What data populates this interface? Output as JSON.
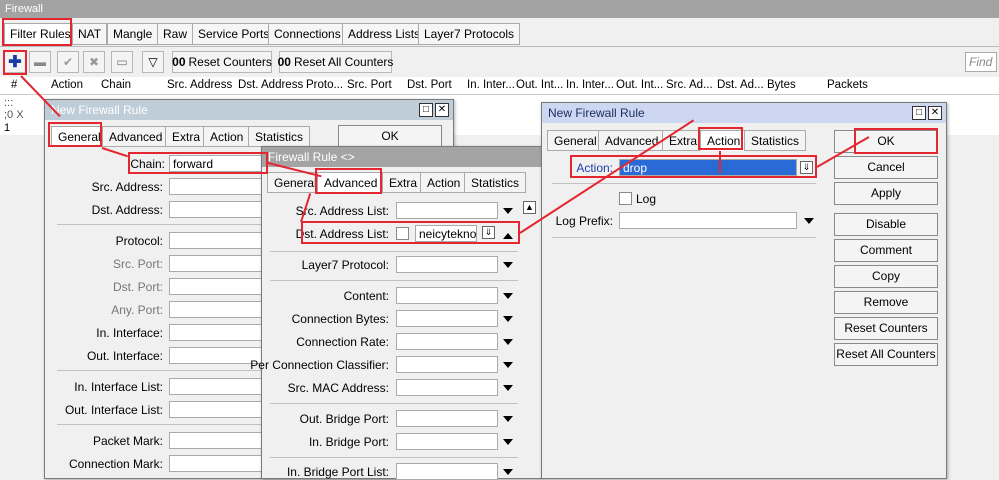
{
  "window": {
    "title": "Firewall"
  },
  "tabs": [
    "Filter Rules",
    "NAT",
    "Mangle",
    "Raw",
    "Service Ports",
    "Connections",
    "Address Lists",
    "Layer7 Protocols"
  ],
  "toolbar": {
    "reset_counters": "Reset Counters",
    "reset_all_counters": "Reset All Counters",
    "find_placeholder": "Find"
  },
  "columns": [
    "#",
    "Action",
    "Chain",
    "Src. Address",
    "Dst. Address",
    "Proto...",
    "Src. Port",
    "Dst. Port",
    "In. Inter...",
    "Out. Int...",
    "In. Inter...",
    "Out. Int...",
    "Src. Ad...",
    "Dst. Ad...",
    "Bytes",
    "Packets"
  ],
  "rows": [
    ":::",
    ";0 X",
    "1"
  ],
  "dlg1": {
    "title": "New Firewall Rule",
    "tabs": [
      "General",
      "Advanced",
      "Extra",
      "Action",
      "Statistics"
    ],
    "ok": "OK",
    "chain_label": "Chain:",
    "chain_value": "forward",
    "fields": [
      "Src. Address:",
      "Dst. Address:",
      "Protocol:",
      "Src. Port:",
      "Dst. Port:",
      "Any. Port:",
      "In. Interface:",
      "Out. Interface:",
      "In. Interface List:",
      "Out. Interface List:",
      "Packet Mark:",
      "Connection Mark:"
    ]
  },
  "dlg2": {
    "title": "Firewall Rule <>",
    "tabs": [
      "General",
      "Advanced",
      "Extra",
      "Action",
      "Statistics"
    ],
    "src_list": "Src. Address List:",
    "dst_list": "Dst. Address List:",
    "dst_list_value": "neicytekno",
    "fields": [
      "Layer7 Protocol:",
      "Content:",
      "Connection Bytes:",
      "Connection Rate:",
      "Per Connection Classifier:",
      "Src. MAC Address:",
      "Out. Bridge Port:",
      "In. Bridge Port:",
      "In. Bridge Port List:"
    ]
  },
  "dlg3": {
    "title": "New Firewall Rule",
    "tabs": [
      "General",
      "Advanced",
      "Extra",
      "Action",
      "Statistics"
    ],
    "action_label": "Action:",
    "action_value": "drop",
    "log_label": "Log",
    "log_prefix": "Log Prefix:",
    "buttons": [
      "OK",
      "Cancel",
      "Apply",
      "Disable",
      "Comment",
      "Copy",
      "Remove",
      "Reset Counters",
      "Reset All Counters"
    ]
  }
}
